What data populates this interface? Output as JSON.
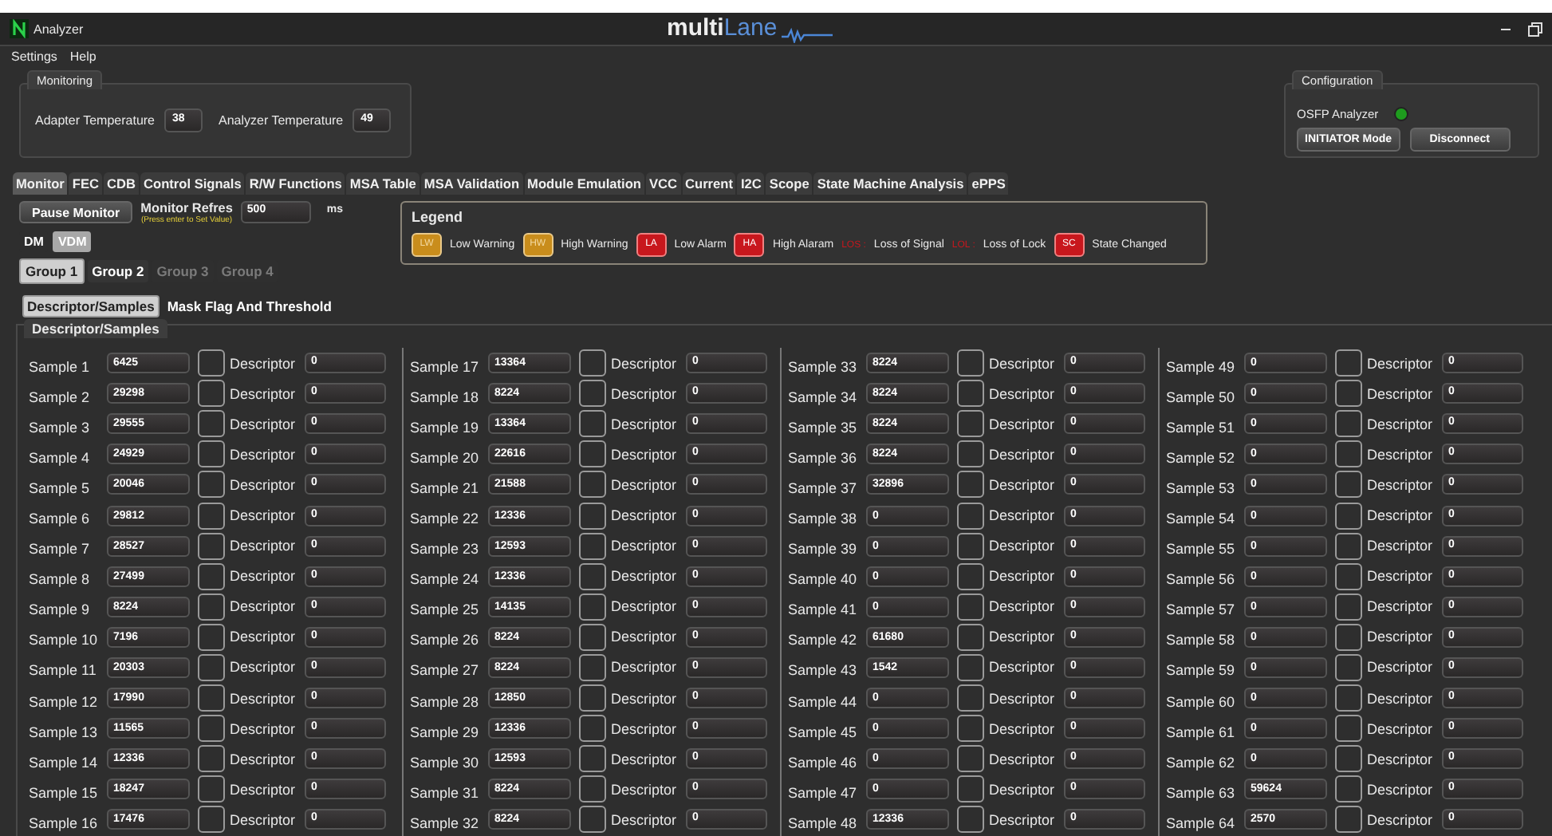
{
  "window": {
    "title": "Analyzer",
    "logo": [
      "multi",
      "Lane"
    ]
  },
  "menu": [
    {
      "label": "Settings"
    },
    {
      "label": "Help"
    }
  ],
  "monitoring": {
    "title": "Monitoring",
    "fields": [
      {
        "label": "Adapter Temperature",
        "value": "38"
      },
      {
        "label": "Analyzer Temperature",
        "value": "49"
      }
    ]
  },
  "configuration": {
    "title": "Configuration",
    "device": "OSFP Analyzer",
    "connected": true,
    "buttons": [
      "INITIATOR Mode",
      "Disconnect"
    ]
  },
  "tabs": [
    {
      "label": "Monitor",
      "selected": true
    },
    {
      "label": "FEC",
      "selected": false
    },
    {
      "label": "CDB",
      "selected": false
    },
    {
      "label": "Control Signals",
      "selected": false
    },
    {
      "label": "R/W Functions",
      "selected": false
    },
    {
      "label": "MSA Table",
      "selected": false
    },
    {
      "label": "MSA Validation",
      "selected": false
    },
    {
      "label": "Module Emulation",
      "selected": false
    },
    {
      "label": "VCC",
      "selected": false
    },
    {
      "label": "Current",
      "selected": false
    },
    {
      "label": "I2C",
      "selected": false
    },
    {
      "label": "Scope",
      "selected": false
    },
    {
      "label": "State Machine Analysis",
      "selected": false
    },
    {
      "label": "ePPS",
      "selected": false
    }
  ],
  "monitor_controls": {
    "pause_button": "Pause Monitor",
    "refresh_label": "Monitor Refres",
    "refresh_value": "500",
    "refresh_unit": "ms",
    "hint": "(Press enter to Set Value)"
  },
  "modes": [
    {
      "label": "DM",
      "selected": false
    },
    {
      "label": "VDM",
      "selected": true
    }
  ],
  "groups": [
    {
      "label": "Group 1",
      "selected": true,
      "disabled": false
    },
    {
      "label": "Group 2",
      "selected": false,
      "disabled": false
    },
    {
      "label": "Group 3",
      "selected": false,
      "disabled": true
    },
    {
      "label": "Group 4",
      "selected": false,
      "disabled": true
    }
  ],
  "legend": {
    "title": "Legend",
    "items": [
      {
        "kind": "badge",
        "code": "LW",
        "label": "Low Warning",
        "color": "#c98d1c"
      },
      {
        "kind": "badge",
        "code": "HW",
        "label": "High Warning",
        "color": "#c98d1c"
      },
      {
        "kind": "badge",
        "code": "LA",
        "label": "Low Alarm",
        "color": "#c8171d"
      },
      {
        "kind": "badge",
        "code": "HA",
        "label": "High Alaram",
        "color": "#c8171d"
      },
      {
        "kind": "text",
        "code": "LOS :",
        "label": "Loss of Signal",
        "color": "#c8171d"
      },
      {
        "kind": "text",
        "code": "LOL :",
        "label": "Loss of Lock",
        "color": "#c8171d"
      },
      {
        "kind": "badge",
        "code": "SC",
        "label": "State Changed",
        "color": "#c8171d"
      }
    ]
  },
  "subtabs": [
    {
      "label": "Descriptor/Samples",
      "selected": true
    },
    {
      "label": "Mask Flag And Threshold",
      "selected": false
    }
  ],
  "panel": {
    "title": "Descriptor/Samples",
    "columns": [
      {
        "rows": [
          {
            "label": "Sample 1",
            "value": "6425",
            "checked": false,
            "descriptor_label": "Descriptor",
            "descriptor": "0"
          },
          {
            "label": "Sample 2",
            "value": "29298",
            "checked": false,
            "descriptor_label": "Descriptor",
            "descriptor": "0"
          },
          {
            "label": "Sample 3",
            "value": "29555",
            "checked": false,
            "descriptor_label": "Descriptor",
            "descriptor": "0"
          },
          {
            "label": "Sample 4",
            "value": "24929",
            "checked": false,
            "descriptor_label": "Descriptor",
            "descriptor": "0"
          },
          {
            "label": "Sample 5",
            "value": "20046",
            "checked": false,
            "descriptor_label": "Descriptor",
            "descriptor": "0"
          },
          {
            "label": "Sample 6",
            "value": "29812",
            "checked": false,
            "descriptor_label": "Descriptor",
            "descriptor": "0"
          },
          {
            "label": "Sample 7",
            "value": "28527",
            "checked": false,
            "descriptor_label": "Descriptor",
            "descriptor": "0"
          },
          {
            "label": "Sample 8",
            "value": "27499",
            "checked": false,
            "descriptor_label": "Descriptor",
            "descriptor": "0"
          },
          {
            "label": "Sample 9",
            "value": "8224",
            "checked": false,
            "descriptor_label": "Descriptor",
            "descriptor": "0"
          },
          {
            "label": "Sample 10",
            "value": "7196",
            "checked": false,
            "descriptor_label": "Descriptor",
            "descriptor": "0"
          },
          {
            "label": "Sample 11",
            "value": "20303",
            "checked": false,
            "descriptor_label": "Descriptor",
            "descriptor": "0"
          },
          {
            "label": "Sample 12",
            "value": "17990",
            "checked": false,
            "descriptor_label": "Descriptor",
            "descriptor": "0"
          },
          {
            "label": "Sample 13",
            "value": "11565",
            "checked": false,
            "descriptor_label": "Descriptor",
            "descriptor": "0"
          },
          {
            "label": "Sample 14",
            "value": "12336",
            "checked": false,
            "descriptor_label": "Descriptor",
            "descriptor": "0"
          },
          {
            "label": "Sample 15",
            "value": "18247",
            "checked": false,
            "descriptor_label": "Descriptor",
            "descriptor": "0"
          },
          {
            "label": "Sample 16",
            "value": "17476",
            "checked": false,
            "descriptor_label": "Descriptor",
            "descriptor": "0"
          }
        ]
      },
      {
        "rows": [
          {
            "label": "Sample 17",
            "value": "13364",
            "checked": false,
            "descriptor_label": "Descriptor",
            "descriptor": "0"
          },
          {
            "label": "Sample 18",
            "value": "8224",
            "checked": false,
            "descriptor_label": "Descriptor",
            "descriptor": "0"
          },
          {
            "label": "Sample 19",
            "value": "13364",
            "checked": false,
            "descriptor_label": "Descriptor",
            "descriptor": "0"
          },
          {
            "label": "Sample 20",
            "value": "22616",
            "checked": false,
            "descriptor_label": "Descriptor",
            "descriptor": "0"
          },
          {
            "label": "Sample 21",
            "value": "21588",
            "checked": false,
            "descriptor_label": "Descriptor",
            "descriptor": "0"
          },
          {
            "label": "Sample 22",
            "value": "12336",
            "checked": false,
            "descriptor_label": "Descriptor",
            "descriptor": "0"
          },
          {
            "label": "Sample 23",
            "value": "12593",
            "checked": false,
            "descriptor_label": "Descriptor",
            "descriptor": "0"
          },
          {
            "label": "Sample 24",
            "value": "12336",
            "checked": false,
            "descriptor_label": "Descriptor",
            "descriptor": "0"
          },
          {
            "label": "Sample 25",
            "value": "14135",
            "checked": false,
            "descriptor_label": "Descriptor",
            "descriptor": "0"
          },
          {
            "label": "Sample 26",
            "value": "8224",
            "checked": false,
            "descriptor_label": "Descriptor",
            "descriptor": "0"
          },
          {
            "label": "Sample 27",
            "value": "8224",
            "checked": false,
            "descriptor_label": "Descriptor",
            "descriptor": "0"
          },
          {
            "label": "Sample 28",
            "value": "12850",
            "checked": false,
            "descriptor_label": "Descriptor",
            "descriptor": "0"
          },
          {
            "label": "Sample 29",
            "value": "12336",
            "checked": false,
            "descriptor_label": "Descriptor",
            "descriptor": "0"
          },
          {
            "label": "Sample 30",
            "value": "12593",
            "checked": false,
            "descriptor_label": "Descriptor",
            "descriptor": "0"
          },
          {
            "label": "Sample 31",
            "value": "8224",
            "checked": false,
            "descriptor_label": "Descriptor",
            "descriptor": "0"
          },
          {
            "label": "Sample 32",
            "value": "8224",
            "checked": false,
            "descriptor_label": "Descriptor",
            "descriptor": "0"
          }
        ]
      },
      {
        "rows": [
          {
            "label": "Sample 33",
            "value": "8224",
            "checked": false,
            "descriptor_label": "Descriptor",
            "descriptor": "0"
          },
          {
            "label": "Sample 34",
            "value": "8224",
            "checked": false,
            "descriptor_label": "Descriptor",
            "descriptor": "0"
          },
          {
            "label": "Sample 35",
            "value": "8224",
            "checked": false,
            "descriptor_label": "Descriptor",
            "descriptor": "0"
          },
          {
            "label": "Sample 36",
            "value": "8224",
            "checked": false,
            "descriptor_label": "Descriptor",
            "descriptor": "0"
          },
          {
            "label": "Sample 37",
            "value": "32896",
            "checked": false,
            "descriptor_label": "Descriptor",
            "descriptor": "0"
          },
          {
            "label": "Sample 38",
            "value": "0",
            "checked": false,
            "descriptor_label": "Descriptor",
            "descriptor": "0"
          },
          {
            "label": "Sample 39",
            "value": "0",
            "checked": false,
            "descriptor_label": "Descriptor",
            "descriptor": "0"
          },
          {
            "label": "Sample 40",
            "value": "0",
            "checked": false,
            "descriptor_label": "Descriptor",
            "descriptor": "0"
          },
          {
            "label": "Sample 41",
            "value": "0",
            "checked": false,
            "descriptor_label": "Descriptor",
            "descriptor": "0"
          },
          {
            "label": "Sample 42",
            "value": "61680",
            "checked": false,
            "descriptor_label": "Descriptor",
            "descriptor": "0"
          },
          {
            "label": "Sample 43",
            "value": "1542",
            "checked": false,
            "descriptor_label": "Descriptor",
            "descriptor": "0"
          },
          {
            "label": "Sample 44",
            "value": "0",
            "checked": false,
            "descriptor_label": "Descriptor",
            "descriptor": "0"
          },
          {
            "label": "Sample 45",
            "value": "0",
            "checked": false,
            "descriptor_label": "Descriptor",
            "descriptor": "0"
          },
          {
            "label": "Sample 46",
            "value": "0",
            "checked": false,
            "descriptor_label": "Descriptor",
            "descriptor": "0"
          },
          {
            "label": "Sample 47",
            "value": "0",
            "checked": false,
            "descriptor_label": "Descriptor",
            "descriptor": "0"
          },
          {
            "label": "Sample 48",
            "value": "12336",
            "checked": false,
            "descriptor_label": "Descriptor",
            "descriptor": "0"
          }
        ]
      },
      {
        "rows": [
          {
            "label": "Sample 49",
            "value": "0",
            "checked": false,
            "descriptor_label": "Descriptor",
            "descriptor": "0"
          },
          {
            "label": "Sample 50",
            "value": "0",
            "checked": false,
            "descriptor_label": "Descriptor",
            "descriptor": "0"
          },
          {
            "label": "Sample 51",
            "value": "0",
            "checked": false,
            "descriptor_label": "Descriptor",
            "descriptor": "0"
          },
          {
            "label": "Sample 52",
            "value": "0",
            "checked": false,
            "descriptor_label": "Descriptor",
            "descriptor": "0"
          },
          {
            "label": "Sample 53",
            "value": "0",
            "checked": false,
            "descriptor_label": "Descriptor",
            "descriptor": "0"
          },
          {
            "label": "Sample 54",
            "value": "0",
            "checked": false,
            "descriptor_label": "Descriptor",
            "descriptor": "0"
          },
          {
            "label": "Sample 55",
            "value": "0",
            "checked": false,
            "descriptor_label": "Descriptor",
            "descriptor": "0"
          },
          {
            "label": "Sample 56",
            "value": "0",
            "checked": false,
            "descriptor_label": "Descriptor",
            "descriptor": "0"
          },
          {
            "label": "Sample 57",
            "value": "0",
            "checked": false,
            "descriptor_label": "Descriptor",
            "descriptor": "0"
          },
          {
            "label": "Sample 58",
            "value": "0",
            "checked": false,
            "descriptor_label": "Descriptor",
            "descriptor": "0"
          },
          {
            "label": "Sample 59",
            "value": "0",
            "checked": false,
            "descriptor_label": "Descriptor",
            "descriptor": "0"
          },
          {
            "label": "Sample 60",
            "value": "0",
            "checked": false,
            "descriptor_label": "Descriptor",
            "descriptor": "0"
          },
          {
            "label": "Sample 61",
            "value": "0",
            "checked": false,
            "descriptor_label": "Descriptor",
            "descriptor": "0"
          },
          {
            "label": "Sample 62",
            "value": "0",
            "checked": false,
            "descriptor_label": "Descriptor",
            "descriptor": "0"
          },
          {
            "label": "Sample 63",
            "value": "59624",
            "checked": false,
            "descriptor_label": "Descriptor",
            "descriptor": "0"
          },
          {
            "label": "Sample 64",
            "value": "2570",
            "checked": false,
            "descriptor_label": "Descriptor",
            "descriptor": "0"
          }
        ]
      }
    ]
  }
}
